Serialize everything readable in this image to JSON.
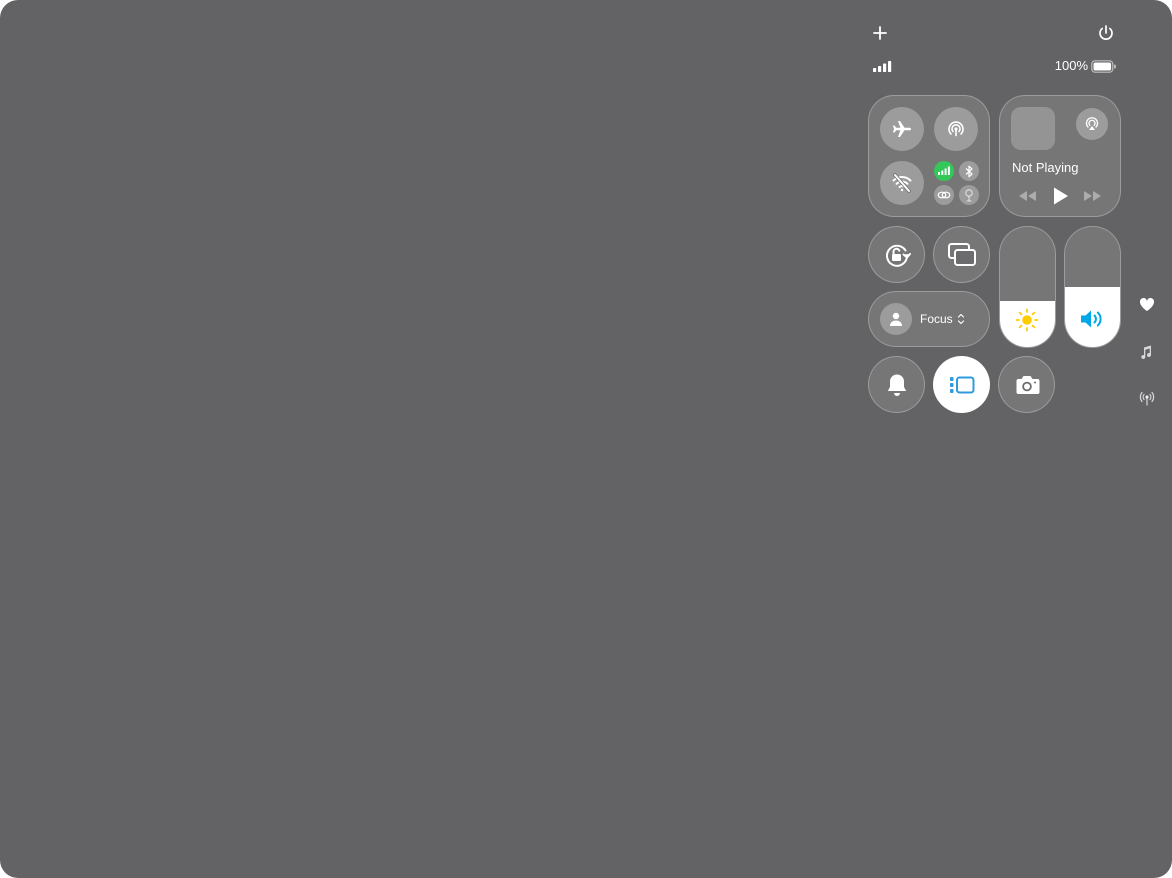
{
  "status": {
    "battery_text": "100%",
    "battery_level": 1.0,
    "signal_bars": 4
  },
  "media": {
    "now_playing": "Not Playing"
  },
  "focus": {
    "label": "Focus"
  },
  "sliders": {
    "brightness_level": 0.38,
    "volume_level": 0.5
  },
  "icons": {
    "top_left": "plus-icon",
    "top_right": "power-icon",
    "airplane": "airplane-icon",
    "airdrop": "airdrop-icon",
    "wifi": "wifi-off-icon",
    "cellular": "cellular-icon",
    "bluetooth": "bluetooth-icon",
    "personal_hotspot": "link-icon",
    "satellite": "satellite-icon",
    "airplay": "airplay-icon",
    "orientation_lock": "rotation-lock-icon",
    "screen_mirroring": "screen-mirroring-icon",
    "focus": "person-icon",
    "brightness": "sun-icon",
    "volume": "speaker-icon",
    "silent": "bell-icon",
    "stage_manager": "stage-manager-icon",
    "camera": "camera-icon",
    "side_favorites": "heart-icon",
    "side_music": "music-note-icon",
    "side_connectivity": "antenna-icon"
  },
  "colors": {
    "background": "#636365",
    "cellular_active": "#34c759",
    "brightness_accent": "#ffcc00",
    "volume_accent": "#00a8e8",
    "stage_manager_accent": "#2f9bdc"
  }
}
